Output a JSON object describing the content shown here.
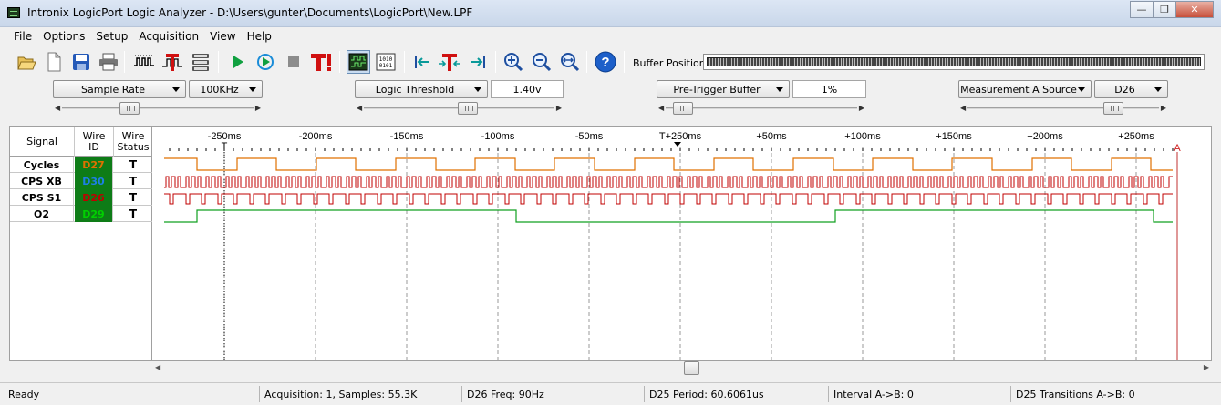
{
  "window": {
    "title": "Intronix LogicPort Logic Analyzer - D:\\Users\\gunter\\Documents\\LogicPort\\New.LPF",
    "minimize": "—",
    "restore": "❐",
    "close": "✕"
  },
  "menu": [
    "File",
    "Options",
    "Setup",
    "Acquisition",
    "View",
    "Help"
  ],
  "toolbar": {
    "buffer_label": "Buffer Position:",
    "buttons": [
      "open-icon",
      "new-file-icon",
      "save-icon",
      "print-icon",
      "signal-config-icon",
      "trigger-config-icon",
      "interpreter-icon",
      "run-icon",
      "run-repeat-icon",
      "stop-icon",
      "force-trigger-icon",
      "waveform-view-icon",
      "binary-view-icon",
      "go-to-start-icon",
      "go-to-trigger-icon",
      "go-to-end-icon",
      "zoom-in-icon",
      "zoom-out-icon",
      "zoom-fit-icon",
      "help-icon"
    ]
  },
  "controls": {
    "sample_rate": {
      "label": "Sample Rate",
      "value": "100KHz"
    },
    "logic_threshold": {
      "label": "Logic Threshold",
      "value": "1.40v",
      "slider": 0.55
    },
    "pre_trigger": {
      "label": "Pre-Trigger Buffer",
      "value": "1%",
      "slider": 0.03
    },
    "measurement": {
      "label": "Measurement A Source",
      "value": "D26",
      "slider": 0.8
    },
    "sample_rate_slider": 0.33
  },
  "signals": {
    "headers": {
      "signal": "Signal",
      "wire_id": "Wire ID",
      "wire_status": "Wire Status"
    },
    "rows": [
      {
        "name": "Cycles",
        "wire": "D27",
        "status": "T",
        "color": "#e07000"
      },
      {
        "name": "CPS XB",
        "wire": "D30",
        "status": "T",
        "color": "#1e7fe6"
      },
      {
        "name": "CPS S1",
        "wire": "D26",
        "status": "T",
        "color": "#c00000"
      },
      {
        "name": "O2",
        "wire": "D29",
        "status": "T",
        "color": "#00d000"
      }
    ]
  },
  "timeline": {
    "ticks": [
      "-250ms",
      "-200ms",
      "-150ms",
      "-100ms",
      "-50ms",
      "T+250ms",
      "+50ms",
      "+100ms",
      "+150ms",
      "+200ms",
      "+250ms"
    ],
    "trigger_marker": "T",
    "cursor_marker": "A"
  },
  "status": {
    "ready": "Ready",
    "acquisition": "Acquisition: 1, Samples: 55.3K",
    "freq": "D26 Freq: 90Hz",
    "period": "D25 Period: 60.6061us",
    "interval": "Interval A->B: 0",
    "transitions": "D25 Transitions A->B: 0"
  }
}
